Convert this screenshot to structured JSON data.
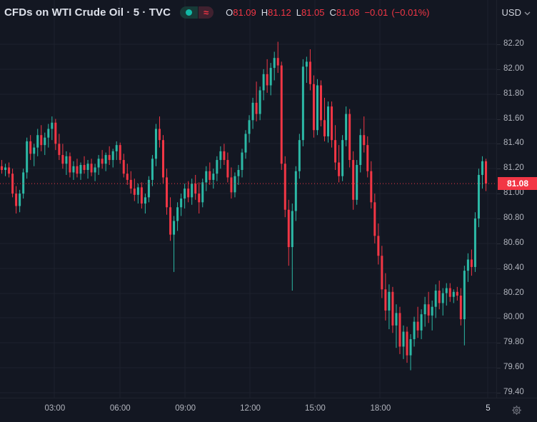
{
  "header": {
    "symbol_title": "CFDs on WTI Crude Oil · 5 · TVC",
    "delayed_glyph": "≈",
    "ohlc": {
      "o_label": "O",
      "o_value": "81.09",
      "h_label": "H",
      "h_value": "81.12",
      "l_label": "L",
      "l_value": "81.05",
      "c_label": "C",
      "c_value": "81.08",
      "change": "−0.01",
      "change_pct": "(−0.01%)"
    },
    "currency": "USD"
  },
  "colors": {
    "background": "#131722",
    "grid": "#1e222d",
    "up": "#2cb9a6",
    "down": "#f23645",
    "axis_text": "#b2b5be",
    "badge_bg": "#f23645",
    "badge_text": "#ffffff"
  },
  "chart_data": {
    "type": "candlestick",
    "title": "CFDs on WTI Crude Oil",
    "interval": "5",
    "exchange": "TVC",
    "currency": "USD",
    "legend_position": "top-left",
    "grid": true,
    "ylim": [
      79.365,
      82.355
    ],
    "price_ticks": [
      82.2,
      82.0,
      81.8,
      81.6,
      81.4,
      81.2,
      81.0,
      80.8,
      80.6,
      80.4,
      80.2,
      80.0,
      79.8,
      79.6,
      79.4
    ],
    "time_ticks": [
      {
        "label": "03:00",
        "bar": 14.8,
        "day": false
      },
      {
        "label": "06:00",
        "bar": 33.0,
        "day": false
      },
      {
        "label": "09:00",
        "bar": 51.2,
        "day": false
      },
      {
        "label": "12:00",
        "bar": 69.3,
        "day": false
      },
      {
        "label": "15:00",
        "bar": 87.4,
        "day": false
      },
      {
        "label": "18:00",
        "bar": 105.6,
        "day": false
      },
      {
        "label": "5",
        "bar": 135.6,
        "day": true
      }
    ],
    "last_price": 81.08,
    "last_price_label": "81.08",
    "ohlc_last": {
      "open": 81.09,
      "high": 81.12,
      "low": 81.05,
      "close": 81.08,
      "change": -0.01,
      "change_pct": -0.01
    },
    "candles": [
      [
        81.22,
        81.27,
        81.16,
        81.19
      ],
      [
        81.19,
        81.24,
        81.14,
        81.21
      ],
      [
        81.21,
        81.25,
        81.13,
        81.16
      ],
      [
        81.16,
        81.2,
        80.97,
        81.0
      ],
      [
        81.0,
        81.06,
        80.84,
        80.9
      ],
      [
        80.9,
        81.03,
        80.85,
        81.0
      ],
      [
        81.0,
        81.2,
        80.96,
        81.17
      ],
      [
        81.17,
        81.45,
        81.12,
        81.42
      ],
      [
        81.42,
        81.47,
        81.27,
        81.32
      ],
      [
        81.32,
        81.4,
        81.22,
        81.37
      ],
      [
        81.37,
        81.52,
        81.3,
        81.47
      ],
      [
        81.47,
        81.55,
        81.34,
        81.39
      ],
      [
        81.39,
        81.49,
        81.31,
        81.45
      ],
      [
        81.45,
        81.56,
        81.37,
        81.52
      ],
      [
        81.52,
        81.62,
        81.43,
        81.57
      ],
      [
        81.57,
        81.6,
        81.35,
        81.4
      ],
      [
        81.4,
        81.48,
        81.27,
        81.31
      ],
      [
        81.31,
        81.4,
        81.2,
        81.24
      ],
      [
        81.24,
        81.34,
        81.15,
        81.3
      ],
      [
        81.3,
        81.33,
        81.13,
        81.17
      ],
      [
        81.17,
        81.26,
        81.11,
        81.22
      ],
      [
        81.22,
        81.28,
        81.13,
        81.16
      ],
      [
        81.16,
        81.25,
        81.11,
        81.23
      ],
      [
        81.23,
        81.3,
        81.16,
        81.19
      ],
      [
        81.19,
        81.27,
        81.12,
        81.24
      ],
      [
        81.24,
        81.28,
        81.14,
        81.17
      ],
      [
        81.17,
        81.24,
        81.1,
        81.21
      ],
      [
        81.21,
        81.31,
        81.15,
        81.28
      ],
      [
        81.28,
        81.35,
        81.2,
        81.24
      ],
      [
        81.24,
        81.33,
        81.18,
        81.31
      ],
      [
        81.31,
        81.38,
        81.23,
        81.27
      ],
      [
        81.27,
        81.36,
        81.21,
        81.34
      ],
      [
        81.34,
        81.42,
        81.27,
        81.39
      ],
      [
        81.39,
        81.41,
        81.24,
        81.27
      ],
      [
        81.27,
        81.32,
        81.13,
        81.16
      ],
      [
        81.16,
        81.24,
        81.07,
        81.11
      ],
      [
        81.11,
        81.18,
        81.0,
        81.04
      ],
      [
        81.04,
        81.12,
        80.94,
        80.99
      ],
      [
        80.99,
        81.08,
        80.92,
        81.05
      ],
      [
        81.05,
        81.09,
        80.88,
        80.92
      ],
      [
        80.92,
        81.0,
        80.84,
        80.97
      ],
      [
        80.97,
        81.14,
        80.93,
        81.11
      ],
      [
        81.11,
        81.31,
        81.06,
        81.28
      ],
      [
        81.28,
        81.56,
        81.22,
        81.52
      ],
      [
        81.52,
        81.62,
        81.37,
        81.43
      ],
      [
        81.43,
        81.47,
        81.08,
        81.13
      ],
      [
        81.13,
        81.2,
        80.83,
        80.89
      ],
      [
        80.89,
        80.97,
        80.62,
        80.67
      ],
      [
        80.67,
        80.82,
        80.37,
        80.78
      ],
      [
        80.78,
        80.93,
        80.7,
        80.89
      ],
      [
        80.89,
        81.0,
        80.82,
        80.96
      ],
      [
        80.96,
        81.08,
        80.88,
        81.04
      ],
      [
        81.04,
        81.1,
        80.93,
        80.97
      ],
      [
        80.97,
        81.12,
        80.91,
        81.08
      ],
      [
        81.08,
        81.15,
        80.95,
        81.0
      ],
      [
        81.0,
        81.09,
        80.84,
        80.93
      ],
      [
        80.93,
        81.12,
        80.89,
        81.09
      ],
      [
        81.09,
        81.22,
        81.02,
        81.18
      ],
      [
        81.18,
        81.25,
        81.07,
        81.11
      ],
      [
        81.11,
        81.2,
        81.04,
        81.16
      ],
      [
        81.16,
        81.3,
        81.1,
        81.27
      ],
      [
        81.27,
        81.38,
        81.2,
        81.34
      ],
      [
        81.34,
        81.4,
        81.23,
        81.27
      ],
      [
        81.27,
        81.33,
        81.09,
        81.13
      ],
      [
        81.13,
        81.21,
        80.96,
        81.01
      ],
      [
        81.01,
        81.17,
        80.97,
        81.14
      ],
      [
        81.14,
        81.23,
        81.07,
        81.19
      ],
      [
        81.19,
        81.36,
        81.13,
        81.33
      ],
      [
        81.33,
        81.51,
        81.28,
        81.48
      ],
      [
        81.48,
        81.63,
        81.41,
        81.59
      ],
      [
        81.59,
        81.77,
        81.52,
        81.73
      ],
      [
        81.73,
        81.9,
        81.58,
        81.64
      ],
      [
        81.64,
        81.86,
        81.59,
        81.83
      ],
      [
        81.83,
        82.0,
        81.75,
        81.96
      ],
      [
        81.96,
        82.08,
        81.81,
        81.87
      ],
      [
        81.87,
        82.05,
        81.79,
        82.01
      ],
      [
        82.01,
        82.14,
        81.91,
        82.09
      ],
      [
        82.09,
        82.22,
        81.97,
        82.03
      ],
      [
        82.03,
        82.06,
        81.19,
        81.24
      ],
      [
        81.24,
        81.3,
        80.81,
        80.87
      ],
      [
        80.87,
        80.95,
        80.42,
        80.57
      ],
      [
        80.57,
        80.92,
        80.22,
        80.86
      ],
      [
        80.86,
        81.22,
        80.78,
        81.18
      ],
      [
        81.18,
        81.48,
        81.12,
        81.43
      ],
      [
        81.43,
        82.08,
        81.38,
        82.02
      ],
      [
        82.02,
        82.1,
        81.89,
        82.06
      ],
      [
        82.06,
        82.16,
        81.83,
        81.88
      ],
      [
        81.88,
        81.95,
        81.45,
        81.51
      ],
      [
        81.51,
        81.92,
        81.47,
        81.87
      ],
      [
        81.87,
        81.91,
        81.54,
        81.59
      ],
      [
        81.59,
        81.77,
        81.42,
        81.46
      ],
      [
        81.46,
        81.74,
        81.41,
        81.7
      ],
      [
        81.7,
        81.74,
        81.37,
        81.43
      ],
      [
        81.43,
        81.55,
        81.19,
        81.25
      ],
      [
        81.25,
        81.39,
        81.09,
        81.14
      ],
      [
        81.14,
        81.47,
        81.1,
        81.43
      ],
      [
        81.43,
        81.7,
        81.38,
        81.64
      ],
      [
        81.64,
        81.68,
        81.21,
        81.27
      ],
      [
        81.27,
        81.34,
        80.87,
        80.95
      ],
      [
        80.95,
        81.27,
        80.91,
        81.23
      ],
      [
        81.23,
        81.52,
        81.17,
        81.47
      ],
      [
        81.47,
        81.62,
        81.33,
        81.39
      ],
      [
        81.39,
        81.46,
        81.13,
        81.18
      ],
      [
        81.18,
        81.26,
        80.88,
        80.93
      ],
      [
        80.93,
        81.0,
        80.6,
        80.66
      ],
      [
        80.66,
        80.76,
        80.43,
        80.5
      ],
      [
        80.5,
        80.58,
        80.16,
        80.23
      ],
      [
        80.23,
        80.36,
        79.98,
        80.06
      ],
      [
        80.06,
        80.27,
        79.91,
        80.21
      ],
      [
        80.21,
        80.25,
        79.88,
        79.94
      ],
      [
        79.94,
        80.11,
        79.76,
        80.04
      ],
      [
        80.04,
        80.09,
        79.71,
        79.77
      ],
      [
        79.77,
        79.94,
        79.67,
        79.89
      ],
      [
        79.89,
        79.93,
        79.64,
        79.7
      ],
      [
        79.7,
        79.87,
        79.58,
        79.83
      ],
      [
        79.83,
        80.01,
        79.77,
        79.97
      ],
      [
        79.97,
        80.09,
        79.84,
        79.9
      ],
      [
        79.9,
        80.07,
        79.83,
        80.03
      ],
      [
        80.03,
        80.17,
        79.93,
        80.11
      ],
      [
        80.11,
        80.21,
        79.96,
        80.02
      ],
      [
        80.02,
        80.14,
        79.9,
        80.09
      ],
      [
        80.09,
        80.27,
        80.0,
        80.22
      ],
      [
        80.22,
        80.3,
        80.07,
        80.12
      ],
      [
        80.12,
        80.24,
        80.02,
        80.2
      ],
      [
        80.2,
        80.28,
        80.1,
        80.24
      ],
      [
        80.24,
        80.28,
        80.13,
        80.17
      ],
      [
        80.17,
        80.23,
        80.12,
        80.21
      ],
      [
        80.21,
        80.25,
        80.14,
        80.18
      ],
      [
        80.18,
        80.24,
        79.94,
        79.99
      ],
      [
        79.99,
        80.42,
        79.78,
        80.38
      ],
      [
        80.38,
        80.52,
        80.29,
        80.47
      ],
      [
        80.47,
        80.55,
        80.34,
        80.41
      ],
      [
        80.41,
        80.85,
        80.37,
        80.8
      ],
      [
        80.8,
        81.2,
        80.73,
        81.15
      ],
      [
        81.15,
        81.3,
        81.04,
        81.26
      ],
      [
        81.26,
        81.28,
        81.02,
        81.08
      ]
    ]
  }
}
